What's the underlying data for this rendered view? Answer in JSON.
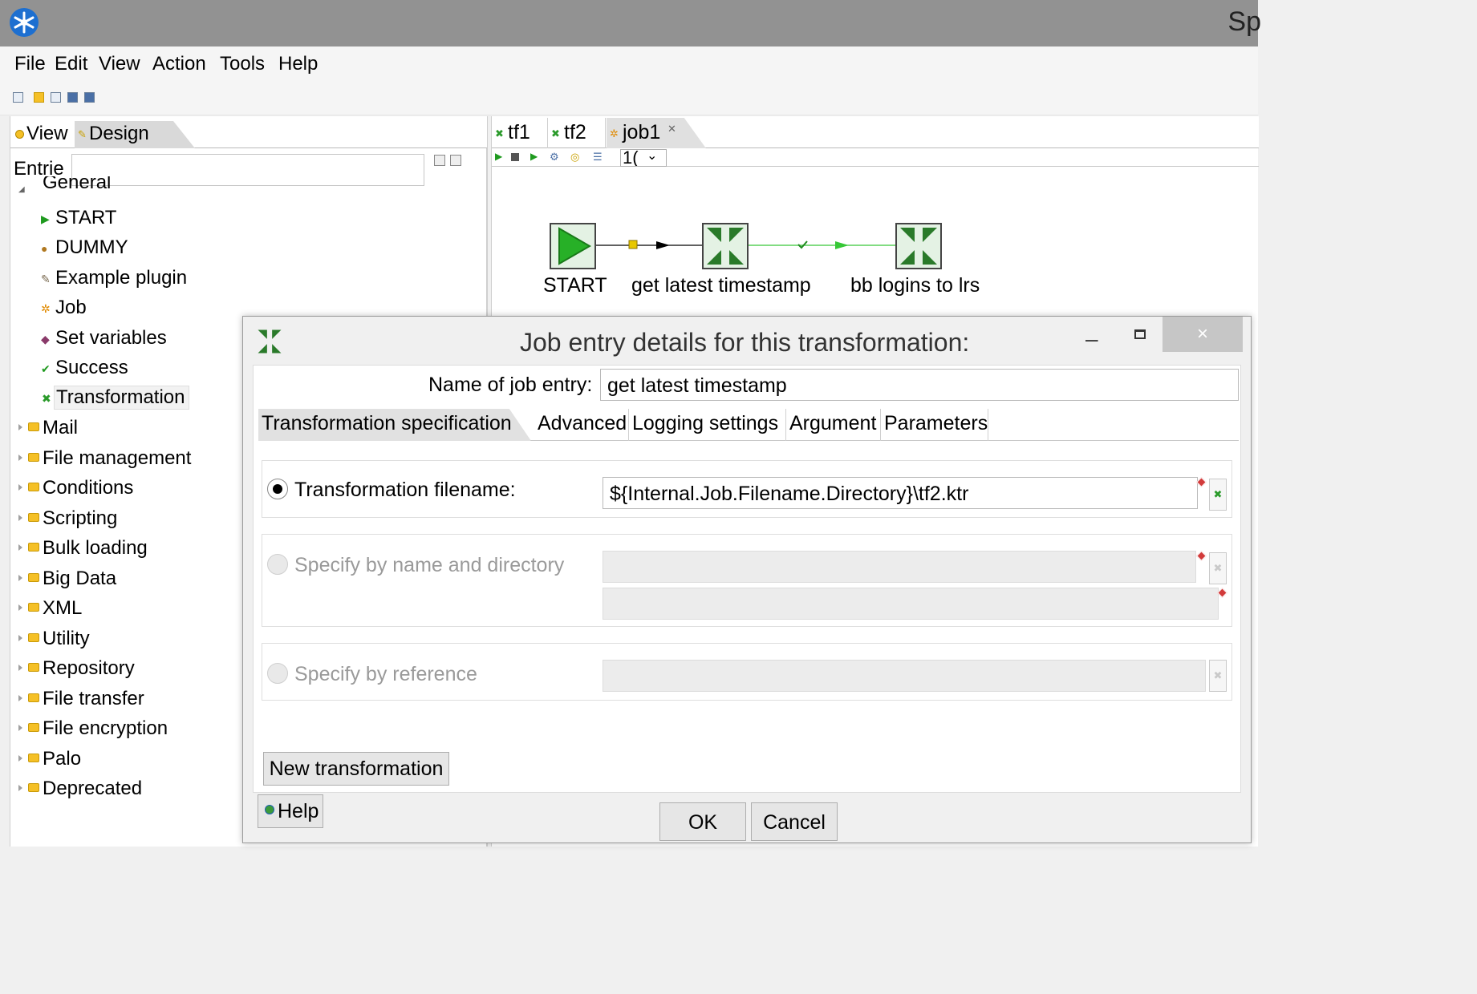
{
  "window": {
    "title": "Sp"
  },
  "menu": [
    "File",
    "Edit",
    "View",
    "Action",
    "Tools",
    "Help"
  ],
  "left_panel": {
    "tabs": [
      "View",
      "Design"
    ],
    "entries_label": "Entrie",
    "tree": {
      "general_label": "General",
      "general_children": [
        "START",
        "DUMMY",
        "Example plugin",
        "Job",
        "Set variables",
        "Success",
        "Transformation"
      ],
      "folders": [
        "Mail",
        "File management",
        "Conditions",
        "Scripting",
        "Bulk loading",
        "Big Data",
        "XML",
        "Utility",
        "Repository",
        "File transfer",
        "File encryption",
        "Palo",
        "Deprecated"
      ]
    }
  },
  "canvas": {
    "tabs": [
      "tf1",
      "tf2",
      "job1"
    ],
    "zoom": "1(",
    "nodes": [
      "START",
      "get latest timestamp",
      "bb logins to lrs"
    ]
  },
  "dialog": {
    "title": "Job entry details for this transformation:",
    "name_label": "Name of job entry:",
    "name_value": "get latest timestamp",
    "tabs": [
      "Transformation specification",
      "Advanced",
      "Logging settings",
      "Argument",
      "Parameters"
    ],
    "radio_filename_label": "Transformation filename:",
    "filename_value": "${Internal.Job.Filename.Directory}\\tf2.ktr",
    "radio_name_dir_label": "Specify by name and directory",
    "radio_reference_label": "Specify by reference",
    "new_transformation_label": "New transformation",
    "help_label": "Help",
    "ok_label": "OK",
    "cancel_label": "Cancel",
    "close_glyph": "×",
    "minimize_glyph": "–"
  },
  "colors": {
    "accent_green": "#2a7a2a",
    "start_green": "#27b027",
    "hop_green": "#37c837"
  }
}
